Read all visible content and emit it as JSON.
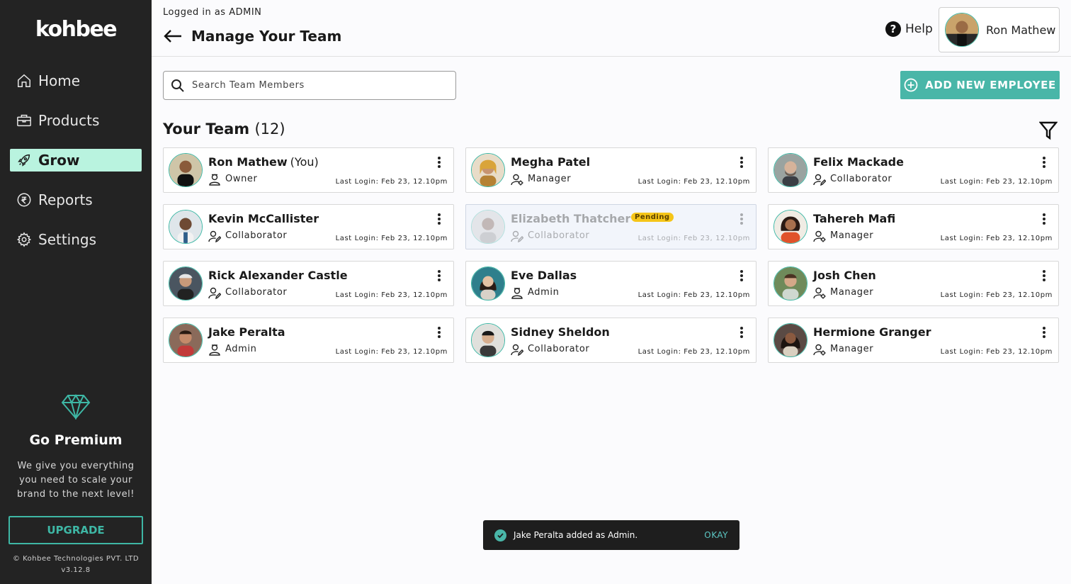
{
  "sidebar": {
    "logo": "kohbee",
    "items": [
      {
        "label": "Home",
        "icon": "home-icon"
      },
      {
        "label": "Products",
        "icon": "briefcase-icon"
      },
      {
        "label": "Grow",
        "icon": "rocket-icon",
        "active": true
      },
      {
        "label": "Reports",
        "icon": "rupee-icon"
      },
      {
        "label": "Settings",
        "icon": "gear-icon"
      }
    ],
    "premium": {
      "icon": "diamond-icon",
      "title": "Go Premium",
      "description": "We give you everything you need to scale your brand to the next level!",
      "button": "UPGRADE"
    },
    "footer_company": "© Kohbee Technologies PVT. LTD",
    "footer_version": "v3.12.8"
  },
  "header": {
    "logged_in": "Logged in as ADMIN",
    "title": "Manage Your Team",
    "help": "Help",
    "user_name": "Ron Mathew"
  },
  "search": {
    "placeholder": "Search Team Members"
  },
  "add_button": "ADD NEW EMPLOYEE",
  "team": {
    "title": "Your Team",
    "count": "(12)",
    "members": [
      {
        "name": "Ron Mathew",
        "suffix": "(You)",
        "role": "Owner",
        "last_login": "Last Login: Feb 23, 12.10pm"
      },
      {
        "name": "Megha Patel",
        "role": "Manager",
        "last_login": "Last Login: Feb 23, 12.10pm"
      },
      {
        "name": "Felix Mackade",
        "role": "Collaborator",
        "last_login": "Last Login: Feb 23, 12.10pm"
      },
      {
        "name": "Kevin McCallister",
        "role": "Collaborator",
        "last_login": "Last Login: Feb 23, 12.10pm"
      },
      {
        "name": "Elizabeth Thatcher",
        "badge": "Pending",
        "role": "Collaborator",
        "last_login": "Last Login: Feb 23, 12.10pm"
      },
      {
        "name": "Tahereh Mafi",
        "role": "Manager",
        "last_login": "Last Login: Feb 23, 12.10pm"
      },
      {
        "name": "Rick Alexander Castle",
        "role": "Collaborator",
        "last_login": "Last Login: Feb 23, 12.10pm"
      },
      {
        "name": "Eve Dallas",
        "role": "Admin",
        "last_login": "Last Login: Feb 23, 12.10pm"
      },
      {
        "name": "Josh Chen",
        "role": "Manager",
        "last_login": "Last Login: Feb 23, 12.10pm"
      },
      {
        "name": "Jake Peralta",
        "role": "Admin",
        "last_login": "Last Login: Feb 23, 12.10pm"
      },
      {
        "name": "Sidney Sheldon",
        "role": "Collaborator",
        "last_login": "Last Login: Feb 23, 12.10pm"
      },
      {
        "name": "Hermione Granger",
        "role": "Manager",
        "last_login": "Last Login: Feb 23, 12.10pm"
      }
    ]
  },
  "toast": {
    "message": "Jake Peralta added as Admin.",
    "action": "OKAY"
  },
  "colors": {
    "accent": "#49b6a8",
    "sidebar_bg": "#232323",
    "active_nav": "#b9f3df",
    "pending_badge": "#f5c518"
  }
}
